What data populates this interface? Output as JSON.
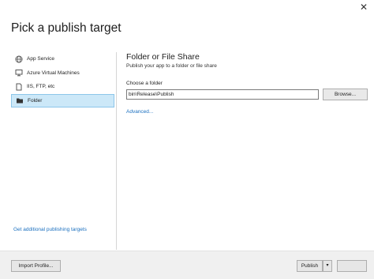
{
  "window": {
    "close_glyph": "✕",
    "title": "Pick a publish target"
  },
  "sidebar": {
    "items": [
      {
        "label": "App Service",
        "icon": "globe-icon"
      },
      {
        "label": "Azure Virtual Machines",
        "icon": "monitor-icon"
      },
      {
        "label": "IIS, FTP, etc",
        "icon": "page-icon"
      },
      {
        "label": "Folder",
        "icon": "folder-icon",
        "selected": true
      }
    ],
    "more_link": "Get additional publishing targets"
  },
  "main": {
    "heading": "Folder or File Share",
    "subheading": "Publish your app to a folder or file share",
    "folder_label": "Choose a folder",
    "folder_value": "bin\\Release\\Publish",
    "browse_label": "Browse...",
    "advanced_link": "Advanced..."
  },
  "footer": {
    "import_label": "Import Profile...",
    "publish_label": "Publish",
    "publish_dropdown_glyph": "▾",
    "cancel_label": ""
  },
  "colors": {
    "accent_link": "#1a6fbf",
    "selection_bg": "#cce8f8",
    "selection_border": "#8cc6ea"
  }
}
